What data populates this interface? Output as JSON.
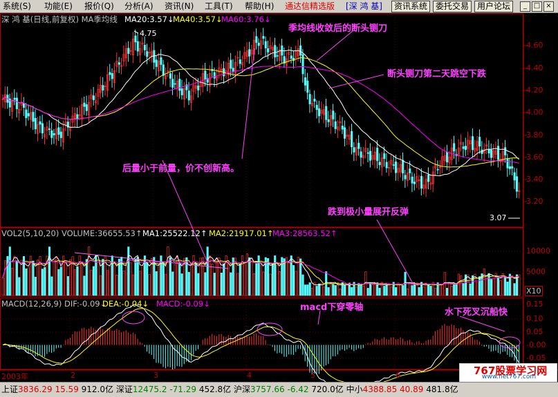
{
  "menu": {
    "items": [
      "系统(S)",
      "功能(E)",
      "报价(Q)",
      "分析(A)",
      "资讯(N)",
      "工具(T)",
      "帮助(H)"
    ],
    "brand": "通达信精选版",
    "stock_tag": "[深 鸿 基]",
    "buttons": [
      "资讯系统",
      "委托交易",
      "用户论坛"
    ]
  },
  "window_controls": [
    "_",
    "□",
    "×"
  ],
  "chart": {
    "header": {
      "title": "深 鸿 基(日线,前复权) MA季均线",
      "ma20": "MA20:3.57↓",
      "ma40": "MA40:3.57↓",
      "ma60": "MA60:3.76↓"
    },
    "price_axis": [
      "4.60",
      "4.40",
      "4.20",
      "4.00",
      "3.80",
      "3.60",
      "3.40",
      "3.20"
    ],
    "high_label": "4.75",
    "low_label": "3.07",
    "volume_header": {
      "vol": "VOL2(5,10,20) VOLUME:36655.53↑",
      "ma1": "MA1:25522.12↑",
      "ma2": "MA2:21917.01↑",
      "ma3": "MA3:28563.52↑"
    },
    "volume_axis": [
      "10000",
      "5000"
    ],
    "volume_unit": "X10",
    "macd_header": {
      "macd": "MACD(12,26,9) DIF:-0.09↓",
      "dea": "DEA:-0.04↓",
      "val": "MACD:-0.09↓"
    },
    "macd_axis": [
      "0.15",
      "0.10",
      "0.05",
      "-0.00",
      "-0.05"
    ],
    "time_axis": [
      "2003年",
      "2",
      "3",
      "4",
      "5",
      "6"
    ]
  },
  "annotations": {
    "a1": "季均线收敛后的断头铡刀",
    "a2": "断头铡刀第二天跳空下跌",
    "a3": "后量小于前量，价不创新高。",
    "a4": "跌到极小量展开反弹",
    "a5": "macd下穿零轴",
    "a6": "水下死叉沉船快"
  },
  "status": {
    "sh_label": "上证",
    "sh_val": "3836.29",
    "sh_chg": "15.59",
    "sh_amt": "912.0亿",
    "sz_label": "深证",
    "sz_val": "12475.2",
    "sz_chg": "-71.29",
    "sz_amt": "452.8亿",
    "hs_label": "沪深",
    "hs_val": "3757.66",
    "hs_chg": "-6.42",
    "hs_amt": "720.0亿",
    "zx_label": "中小",
    "zx_val": "4388.85",
    "zx_chg": "40.89",
    "zx_amt": "481.8亿"
  },
  "watermark": {
    "title": "767股票学习网",
    "url": "www.net767.com"
  },
  "colors": {
    "up": "#ff3232",
    "down": "#54fcfc",
    "ma20": "#ffffff",
    "ma40": "#ffff00",
    "ma60": "#ff00ff",
    "annotation": "#ff40ff"
  }
}
